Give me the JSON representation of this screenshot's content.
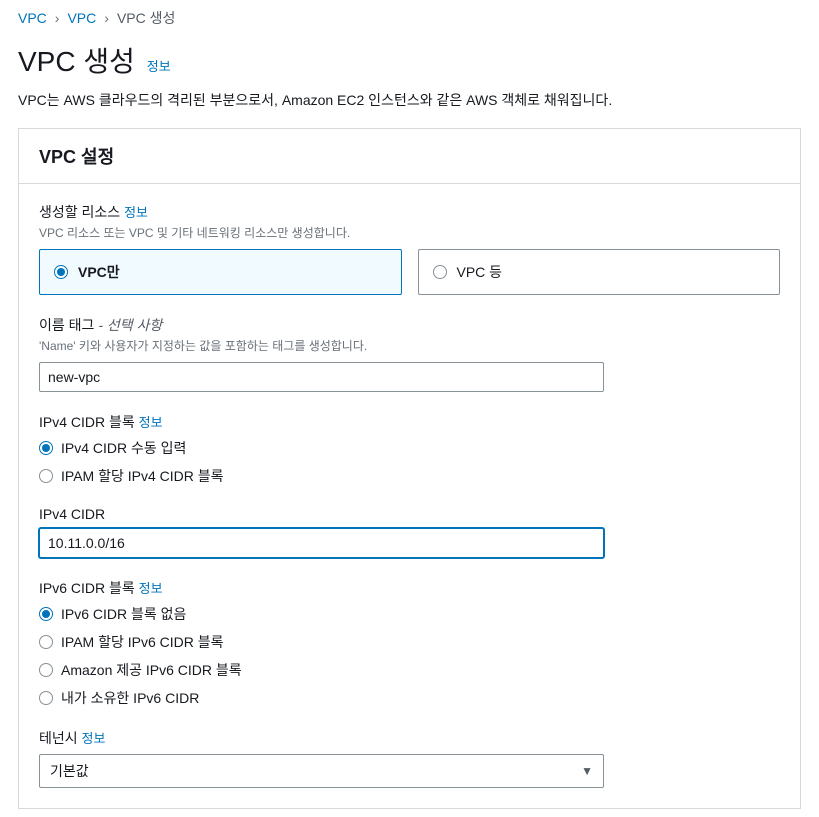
{
  "breadcrumb": {
    "items": [
      "VPC",
      "VPC"
    ],
    "current": "VPC 생성"
  },
  "header": {
    "title": "VPC 생성",
    "info": "정보",
    "description": "VPC는 AWS 클라우드의 격리된 부분으로서, Amazon EC2 인스턴스와 같은 AWS 객체로 채워집니다."
  },
  "panel": {
    "title": "VPC 설정"
  },
  "resources": {
    "label": "생성할 리소스",
    "info": "정보",
    "hint": "VPC 리소스 또는 VPC 및 기타 네트워킹 리소스만 생성합니다.",
    "options": [
      {
        "label": "VPC만",
        "selected": true
      },
      {
        "label": "VPC 등",
        "selected": false
      }
    ]
  },
  "nameTag": {
    "label": "이름 태그 ",
    "optional": "- 선택 사항",
    "hint": "'Name' 키와 사용자가 지정하는 값을 포함하는 태그를 생성합니다.",
    "value": "new-vpc"
  },
  "ipv4Block": {
    "label": "IPv4 CIDR 블록",
    "info": "정보",
    "options": [
      {
        "label": "IPv4 CIDR 수동 입력",
        "selected": true
      },
      {
        "label": "IPAM 할당 IPv4 CIDR 블록",
        "selected": false
      }
    ]
  },
  "ipv4Cidr": {
    "label": "IPv4 CIDR",
    "value": "10.11.0.0/16"
  },
  "ipv6Block": {
    "label": "IPv6 CIDR 블록",
    "info": "정보",
    "options": [
      {
        "label": "IPv6 CIDR 블록 없음",
        "selected": true
      },
      {
        "label": "IPAM 할당 IPv6 CIDR 블록",
        "selected": false
      },
      {
        "label": "Amazon 제공 IPv6 CIDR 블록",
        "selected": false
      },
      {
        "label": "내가 소유한 IPv6 CIDR",
        "selected": false
      }
    ]
  },
  "tenancy": {
    "label": "테넌시",
    "info": "정보",
    "value": "기본값"
  }
}
